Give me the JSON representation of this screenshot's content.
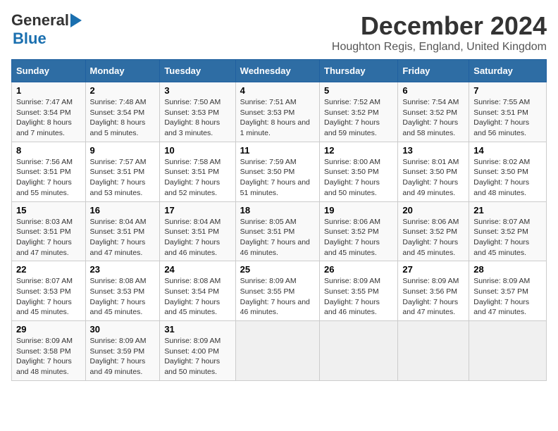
{
  "logo": {
    "part1": "General",
    "part2": "Blue"
  },
  "title": "December 2024",
  "location": "Houghton Regis, England, United Kingdom",
  "days_of_week": [
    "Sunday",
    "Monday",
    "Tuesday",
    "Wednesday",
    "Thursday",
    "Friday",
    "Saturday"
  ],
  "weeks": [
    [
      {
        "day": "1",
        "sunrise": "7:47 AM",
        "sunset": "3:54 PM",
        "daylight": "8 hours and 7 minutes."
      },
      {
        "day": "2",
        "sunrise": "7:48 AM",
        "sunset": "3:54 PM",
        "daylight": "8 hours and 5 minutes."
      },
      {
        "day": "3",
        "sunrise": "7:50 AM",
        "sunset": "3:53 PM",
        "daylight": "8 hours and 3 minutes."
      },
      {
        "day": "4",
        "sunrise": "7:51 AM",
        "sunset": "3:53 PM",
        "daylight": "8 hours and 1 minute."
      },
      {
        "day": "5",
        "sunrise": "7:52 AM",
        "sunset": "3:52 PM",
        "daylight": "7 hours and 59 minutes."
      },
      {
        "day": "6",
        "sunrise": "7:54 AM",
        "sunset": "3:52 PM",
        "daylight": "7 hours and 58 minutes."
      },
      {
        "day": "7",
        "sunrise": "7:55 AM",
        "sunset": "3:51 PM",
        "daylight": "7 hours and 56 minutes."
      }
    ],
    [
      {
        "day": "8",
        "sunrise": "7:56 AM",
        "sunset": "3:51 PM",
        "daylight": "7 hours and 55 minutes."
      },
      {
        "day": "9",
        "sunrise": "7:57 AM",
        "sunset": "3:51 PM",
        "daylight": "7 hours and 53 minutes."
      },
      {
        "day": "10",
        "sunrise": "7:58 AM",
        "sunset": "3:51 PM",
        "daylight": "7 hours and 52 minutes."
      },
      {
        "day": "11",
        "sunrise": "7:59 AM",
        "sunset": "3:50 PM",
        "daylight": "7 hours and 51 minutes."
      },
      {
        "day": "12",
        "sunrise": "8:00 AM",
        "sunset": "3:50 PM",
        "daylight": "7 hours and 50 minutes."
      },
      {
        "day": "13",
        "sunrise": "8:01 AM",
        "sunset": "3:50 PM",
        "daylight": "7 hours and 49 minutes."
      },
      {
        "day": "14",
        "sunrise": "8:02 AM",
        "sunset": "3:50 PM",
        "daylight": "7 hours and 48 minutes."
      }
    ],
    [
      {
        "day": "15",
        "sunrise": "8:03 AM",
        "sunset": "3:51 PM",
        "daylight": "7 hours and 47 minutes."
      },
      {
        "day": "16",
        "sunrise": "8:04 AM",
        "sunset": "3:51 PM",
        "daylight": "7 hours and 47 minutes."
      },
      {
        "day": "17",
        "sunrise": "8:04 AM",
        "sunset": "3:51 PM",
        "daylight": "7 hours and 46 minutes."
      },
      {
        "day": "18",
        "sunrise": "8:05 AM",
        "sunset": "3:51 PM",
        "daylight": "7 hours and 46 minutes."
      },
      {
        "day": "19",
        "sunrise": "8:06 AM",
        "sunset": "3:52 PM",
        "daylight": "7 hours and 45 minutes."
      },
      {
        "day": "20",
        "sunrise": "8:06 AM",
        "sunset": "3:52 PM",
        "daylight": "7 hours and 45 minutes."
      },
      {
        "day": "21",
        "sunrise": "8:07 AM",
        "sunset": "3:52 PM",
        "daylight": "7 hours and 45 minutes."
      }
    ],
    [
      {
        "day": "22",
        "sunrise": "8:07 AM",
        "sunset": "3:53 PM",
        "daylight": "7 hours and 45 minutes."
      },
      {
        "day": "23",
        "sunrise": "8:08 AM",
        "sunset": "3:53 PM",
        "daylight": "7 hours and 45 minutes."
      },
      {
        "day": "24",
        "sunrise": "8:08 AM",
        "sunset": "3:54 PM",
        "daylight": "7 hours and 45 minutes."
      },
      {
        "day": "25",
        "sunrise": "8:09 AM",
        "sunset": "3:55 PM",
        "daylight": "7 hours and 46 minutes."
      },
      {
        "day": "26",
        "sunrise": "8:09 AM",
        "sunset": "3:55 PM",
        "daylight": "7 hours and 46 minutes."
      },
      {
        "day": "27",
        "sunrise": "8:09 AM",
        "sunset": "3:56 PM",
        "daylight": "7 hours and 47 minutes."
      },
      {
        "day": "28",
        "sunrise": "8:09 AM",
        "sunset": "3:57 PM",
        "daylight": "7 hours and 47 minutes."
      }
    ],
    [
      {
        "day": "29",
        "sunrise": "8:09 AM",
        "sunset": "3:58 PM",
        "daylight": "7 hours and 48 minutes."
      },
      {
        "day": "30",
        "sunrise": "8:09 AM",
        "sunset": "3:59 PM",
        "daylight": "7 hours and 49 minutes."
      },
      {
        "day": "31",
        "sunrise": "8:09 AM",
        "sunset": "4:00 PM",
        "daylight": "7 hours and 50 minutes."
      },
      null,
      null,
      null,
      null
    ]
  ]
}
